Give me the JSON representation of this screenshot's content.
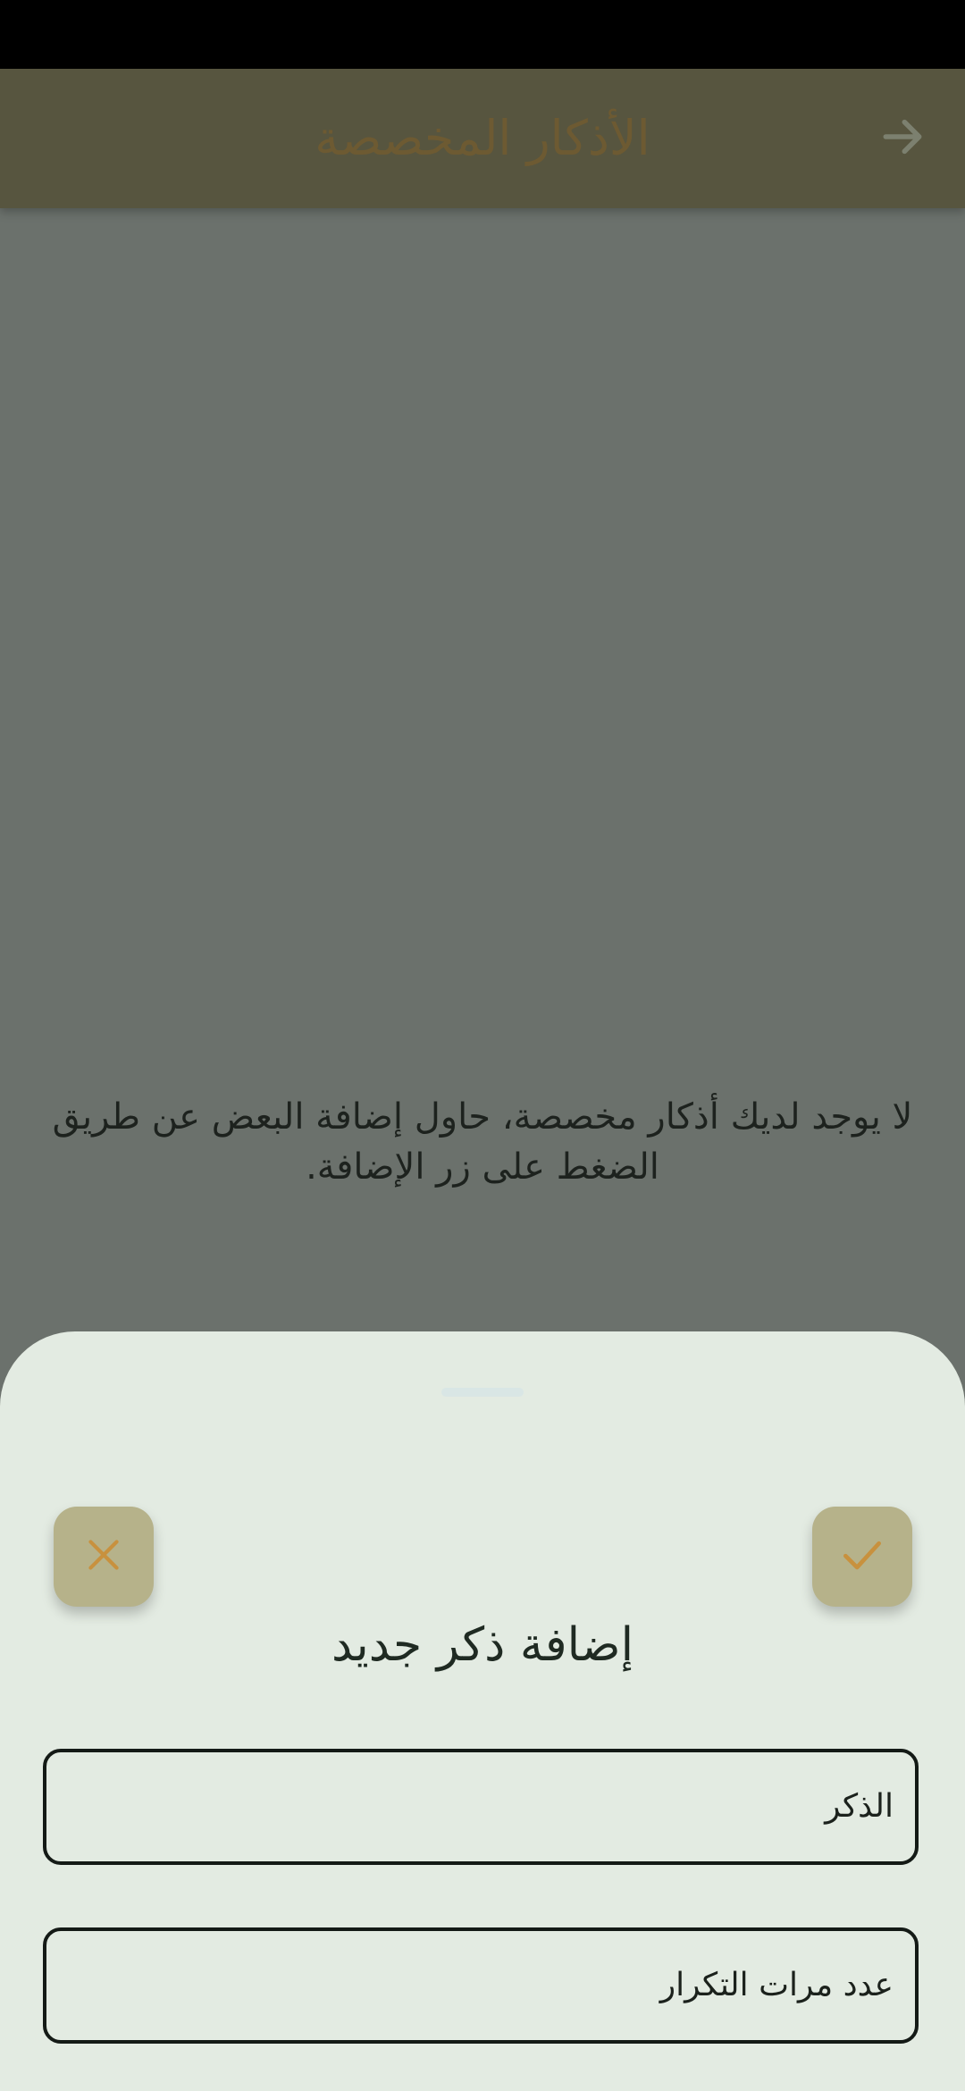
{
  "app_bar": {
    "title": "الأذكار المخصصة",
    "back_icon": "arrow-forward-icon",
    "background_color": "#57553f",
    "title_color": "#6d5a32"
  },
  "empty_state": {
    "message": "لا يوجد لديك أذكار مخصصة، حاول إضافة البعض عن طريق الضغط على زر الإضافة."
  },
  "sheet": {
    "title": "إضافة ذكر جديد",
    "cancel_icon": "close-icon",
    "confirm_icon": "check-icon",
    "accent_color": "#b6b28a",
    "icon_color": "#c8913e",
    "fields": [
      {
        "label": "الذكر"
      },
      {
        "label": "عدد مرات التكرار"
      }
    ]
  }
}
